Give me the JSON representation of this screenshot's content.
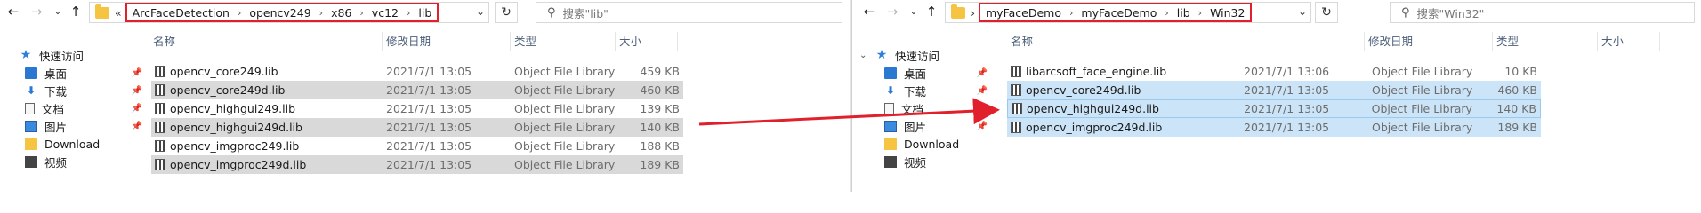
{
  "left": {
    "breadcrumb": [
      "ArcFaceDetection",
      "opencv249",
      "x86",
      "vc12",
      "lib"
    ],
    "search_placeholder": "搜索\"lib\"",
    "columns": {
      "name": "名称",
      "date": "修改日期",
      "type": "类型",
      "size": "大小"
    },
    "files": [
      {
        "name": "opencv_core249.lib",
        "date": "2021/7/1 13:05",
        "type": "Object File Library",
        "size": "459 KB"
      },
      {
        "name": "opencv_core249d.lib",
        "date": "2021/7/1 13:05",
        "type": "Object File Library",
        "size": "460 KB"
      },
      {
        "name": "opencv_highgui249.lib",
        "date": "2021/7/1 13:05",
        "type": "Object File Library",
        "size": "139 KB"
      },
      {
        "name": "opencv_highgui249d.lib",
        "date": "2021/7/1 13:05",
        "type": "Object File Library",
        "size": "140 KB"
      },
      {
        "name": "opencv_imgproc249.lib",
        "date": "2021/7/1 13:05",
        "type": "Object File Library",
        "size": "188 KB"
      },
      {
        "name": "opencv_imgproc249d.lib",
        "date": "2021/7/1 13:05",
        "type": "Object File Library",
        "size": "189 KB"
      }
    ]
  },
  "right": {
    "breadcrumb": [
      "myFaceDemo",
      "myFaceDemo",
      "lib",
      "Win32"
    ],
    "search_placeholder": "搜索\"Win32\"",
    "columns": {
      "name": "名称",
      "date": "修改日期",
      "type": "类型",
      "size": "大小"
    },
    "files": [
      {
        "name": "libarcsoft_face_engine.lib",
        "date": "2021/7/1 13:06",
        "type": "Object File Library",
        "size": "10 KB"
      },
      {
        "name": "opencv_core249d.lib",
        "date": "2021/7/1 13:05",
        "type": "Object File Library",
        "size": "460 KB"
      },
      {
        "name": "opencv_highgui249d.lib",
        "date": "2021/7/1 13:05",
        "type": "Object File Library",
        "size": "140 KB"
      },
      {
        "name": "opencv_imgproc249d.lib",
        "date": "2021/7/1 13:05",
        "type": "Object File Library",
        "size": "189 KB"
      }
    ]
  },
  "nav_pane": {
    "quick_access": "快速访问",
    "items": [
      {
        "label": "桌面",
        "icon": "desktop-icon"
      },
      {
        "label": "下载",
        "icon": "download-icon"
      },
      {
        "label": "文档",
        "icon": "document-icon"
      },
      {
        "label": "图片",
        "icon": "picture-icon"
      },
      {
        "label": "Download",
        "icon": "folder-icon"
      },
      {
        "label": "视频",
        "icon": "video-icon"
      }
    ]
  },
  "colors": {
    "highlight_red": "#e0202a",
    "selection_blue": "#cce4f7",
    "selection_gray": "#d9d9d9"
  }
}
